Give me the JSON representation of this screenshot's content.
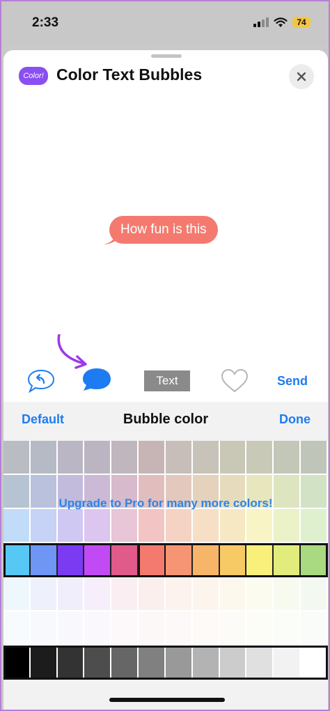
{
  "status": {
    "time": "2:33",
    "battery": "74"
  },
  "header": {
    "title": "Color Text Bubbles",
    "logo_text": "Color!"
  },
  "preview": {
    "message": "How fun is this",
    "bubble_color": "#f47a6f"
  },
  "toolbar": {
    "text_label": "Text",
    "send_label": "Send"
  },
  "panel": {
    "default_label": "Default",
    "title": "Bubble color",
    "done_label": "Done",
    "upgrade_text": "Upgrade to Pro for many more colors!"
  },
  "palette": {
    "rows": [
      [
        "#b9bcc2",
        "#b6bac5",
        "#bab6c4",
        "#bbb5c2",
        "#c0b6bd",
        "#c7b4b5",
        "#c7bdb9",
        "#c8c3b8",
        "#c9c7b6",
        "#c9c9b7",
        "#c3c7b8",
        "#bfc5b8"
      ],
      [
        "#b5c3d2",
        "#b9c1dc",
        "#c2bbdc",
        "#cbb9d6",
        "#d7bacb",
        "#e2bdbd",
        "#e3c8bd",
        "#e5d2bd",
        "#e6dcbd",
        "#e8e6bd",
        "#dde5c0",
        "#d1e2c5"
      ],
      [
        "#c1dcf8",
        "#c6d2f6",
        "#cfc8f2",
        "#dcc6ef",
        "#e8c5d7",
        "#f3c4c4",
        "#f5d3c4",
        "#f6dfc4",
        "#f7e8c4",
        "#f8f4c5",
        "#ebf2c8",
        "#dff0cf"
      ],
      [
        "#57c7f4",
        "#6f95f5",
        "#7a3bf3",
        "#c24af4",
        "#e05a8a",
        "#f47a6f",
        "#f59573",
        "#f6b569",
        "#f7ca66",
        "#f8f07a",
        "#e2ec7d",
        "#a9d980"
      ],
      [
        "#eef7fc",
        "#eef1fb",
        "#f1eefb",
        "#f6eefb",
        "#fbeef3",
        "#fbefee",
        "#fcf2ee",
        "#fcf5ee",
        "#fcf8ee",
        "#fcfbef",
        "#f7faef",
        "#f3f9f0"
      ],
      [
        "#f8fbfd",
        "#f8f9fd",
        "#f9f8fd",
        "#fbf8fd",
        "#fdf8fa",
        "#fdf8f8",
        "#fdf9f8",
        "#fdfaf8",
        "#fdfbf8",
        "#fdfdf8",
        "#fbfdf8",
        "#f9fcf9"
      ],
      [
        "#000000",
        "#1c1c1c",
        "#333333",
        "#4d4d4d",
        "#666666",
        "#808080",
        "#999999",
        "#b3b3b3",
        "#cccccc",
        "#e0e0e0",
        "#f2f2f2",
        "#ffffff"
      ]
    ],
    "selected_row": 3,
    "selected_index": 5,
    "gray_row": 6
  },
  "colors": {
    "accent": "#1e7cf2",
    "bubble_icon": "#1e7cf2",
    "logo": "#8a4ff0",
    "arrow": "#9b3be8"
  },
  "icons": [
    "reply-icon",
    "bubble-color-icon",
    "heart-icon",
    "close-icon",
    "wifi-icon",
    "signal-icon"
  ]
}
